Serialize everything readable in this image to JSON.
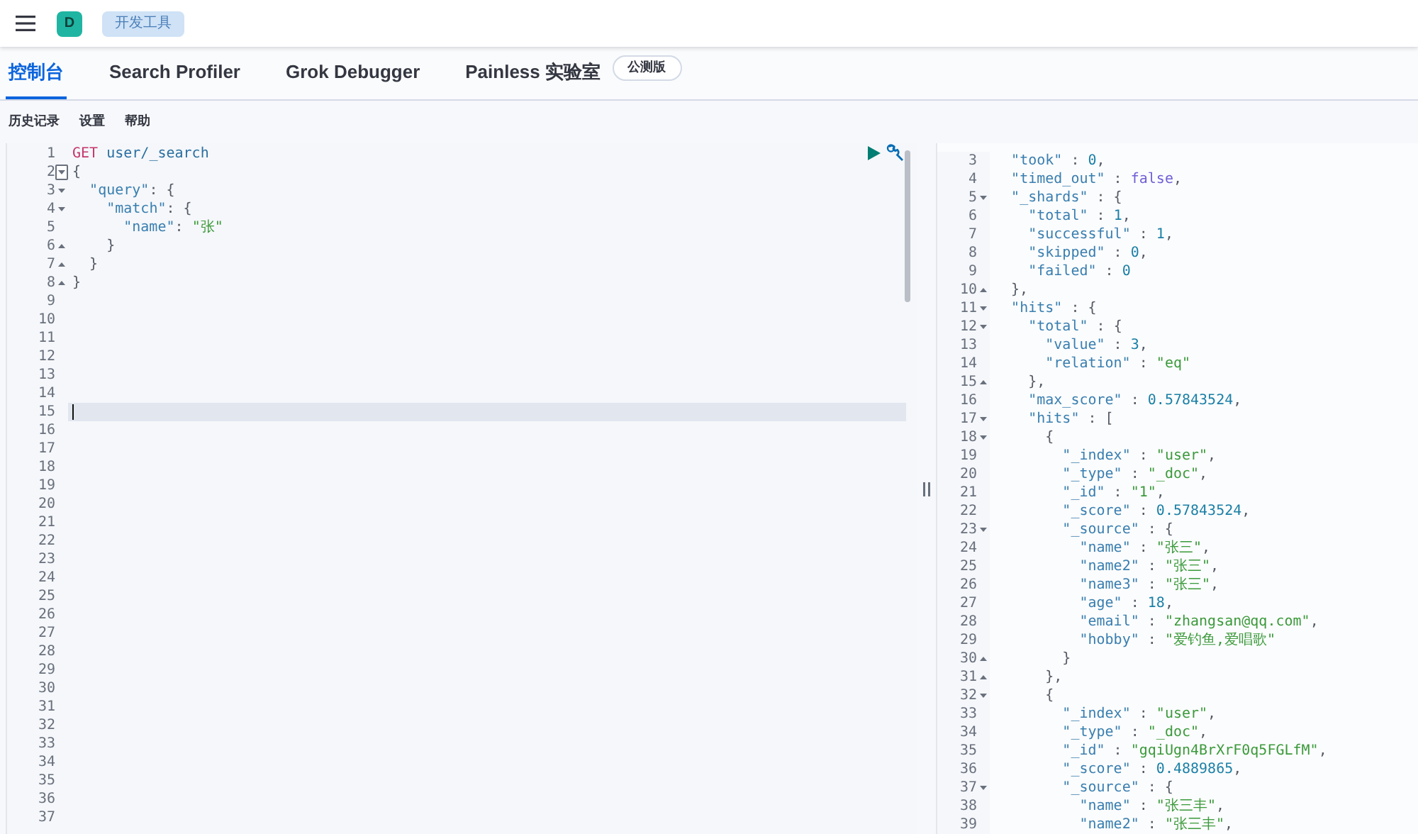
{
  "header": {
    "avatar": "D",
    "breadcrumb": "开发工具"
  },
  "tabs": [
    {
      "label": "控制台",
      "selected": true
    },
    {
      "label": "Search Profiler",
      "selected": false
    },
    {
      "label": "Grok Debugger",
      "selected": false
    },
    {
      "label": "Painless 实验室",
      "selected": false,
      "badge": "公测版"
    }
  ],
  "toolbar": [
    "历史记录",
    "设置",
    "帮助"
  ],
  "request_editor": {
    "lines": [
      {
        "n": "1",
        "method": "GET",
        "url": "user/_search"
      },
      {
        "n": "2",
        "text": "{",
        "fold_start": true,
        "hover": true
      },
      {
        "n": "3",
        "text": "  \"query\": {",
        "fold_start": true
      },
      {
        "n": "4",
        "text": "    \"match\": {",
        "fold_start": true
      },
      {
        "n": "5",
        "text": "      \"name\": \"张\""
      },
      {
        "n": "6",
        "text": "    }",
        "fold_end": true
      },
      {
        "n": "7",
        "text": "  }",
        "fold_end": true
      },
      {
        "n": "8",
        "text": "}",
        "fold_end": true
      },
      {
        "n": "9"
      },
      {
        "n": "10"
      },
      {
        "n": "11"
      },
      {
        "n": "12"
      },
      {
        "n": "13"
      },
      {
        "n": "14"
      },
      {
        "n": "15",
        "active": true
      },
      {
        "n": "16"
      },
      {
        "n": "17"
      },
      {
        "n": "18"
      },
      {
        "n": "19"
      },
      {
        "n": "20"
      },
      {
        "n": "21"
      },
      {
        "n": "22"
      },
      {
        "n": "23"
      },
      {
        "n": "24"
      },
      {
        "n": "25"
      },
      {
        "n": "26"
      },
      {
        "n": "27"
      },
      {
        "n": "28"
      },
      {
        "n": "29"
      },
      {
        "n": "30"
      },
      {
        "n": "31"
      },
      {
        "n": "32"
      },
      {
        "n": "33"
      },
      {
        "n": "34"
      },
      {
        "n": "35"
      },
      {
        "n": "36"
      },
      {
        "n": "37"
      }
    ]
  },
  "response_editor": {
    "lines": [
      {
        "n": "3",
        "text": "  \"took\" : 0,"
      },
      {
        "n": "4",
        "text": "  \"timed_out\" : false,"
      },
      {
        "n": "5",
        "text": "  \"_shards\" : {",
        "fold_start": true
      },
      {
        "n": "6",
        "text": "    \"total\" : 1,"
      },
      {
        "n": "7",
        "text": "    \"successful\" : 1,"
      },
      {
        "n": "8",
        "text": "    \"skipped\" : 0,"
      },
      {
        "n": "9",
        "text": "    \"failed\" : 0"
      },
      {
        "n": "10",
        "text": "  },",
        "fold_end": true
      },
      {
        "n": "11",
        "text": "  \"hits\" : {",
        "fold_start": true
      },
      {
        "n": "12",
        "text": "    \"total\" : {",
        "fold_start": true
      },
      {
        "n": "13",
        "text": "      \"value\" : 3,"
      },
      {
        "n": "14",
        "text": "      \"relation\" : \"eq\""
      },
      {
        "n": "15",
        "text": "    },",
        "fold_end": true
      },
      {
        "n": "16",
        "text": "    \"max_score\" : 0.57843524,"
      },
      {
        "n": "17",
        "text": "    \"hits\" : [",
        "fold_start": true
      },
      {
        "n": "18",
        "text": "      {",
        "fold_start": true
      },
      {
        "n": "19",
        "text": "        \"_index\" : \"user\","
      },
      {
        "n": "20",
        "text": "        \"_type\" : \"_doc\","
      },
      {
        "n": "21",
        "text": "        \"_id\" : \"1\","
      },
      {
        "n": "22",
        "text": "        \"_score\" : 0.57843524,"
      },
      {
        "n": "23",
        "text": "        \"_source\" : {",
        "fold_start": true
      },
      {
        "n": "24",
        "text": "          \"name\" : \"张三\","
      },
      {
        "n": "25",
        "text": "          \"name2\" : \"张三\","
      },
      {
        "n": "26",
        "text": "          \"name3\" : \"张三\","
      },
      {
        "n": "27",
        "text": "          \"age\" : 18,"
      },
      {
        "n": "28",
        "text": "          \"email\" : \"zhangsan@qq.com\","
      },
      {
        "n": "29",
        "text": "          \"hobby\" : \"爱钓鱼,爱唱歌\""
      },
      {
        "n": "30",
        "text": "        }",
        "fold_end": true
      },
      {
        "n": "31",
        "text": "      },",
        "fold_end": true
      },
      {
        "n": "32",
        "text": "      {",
        "fold_start": true
      },
      {
        "n": "33",
        "text": "        \"_index\" : \"user\","
      },
      {
        "n": "34",
        "text": "        \"_type\" : \"_doc\","
      },
      {
        "n": "35",
        "text": "        \"_id\" : \"gqiUgn4BrXrF0q5FGLfM\","
      },
      {
        "n": "36",
        "text": "        \"_score\" : 0.4889865,"
      },
      {
        "n": "37",
        "text": "        \"_source\" : {",
        "fold_start": true
      },
      {
        "n": "38",
        "text": "          \"name\" : \"张三丰\","
      },
      {
        "n": "39",
        "text": "          \"name2\" : \"张三丰\","
      }
    ]
  }
}
